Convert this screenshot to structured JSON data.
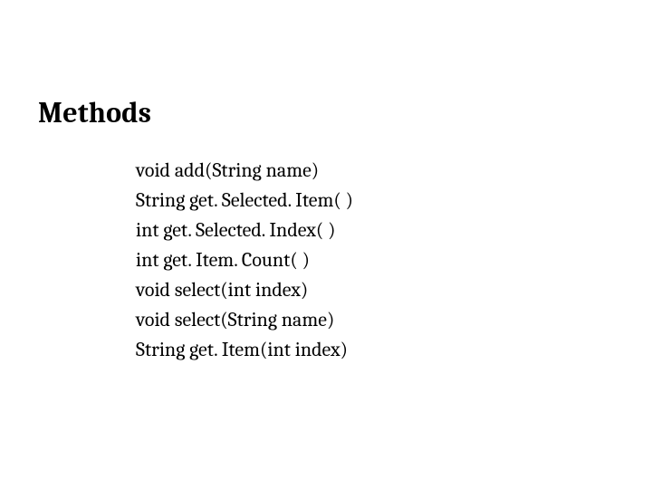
{
  "heading": "Methods",
  "methods": [
    "void add(String name)",
    "String get. Selected. Item( )",
    "int get. Selected. Index( )",
    "int get. Item. Count( )",
    "void select(int index)",
    "void select(String name)",
    "String get. Item(int index)"
  ]
}
